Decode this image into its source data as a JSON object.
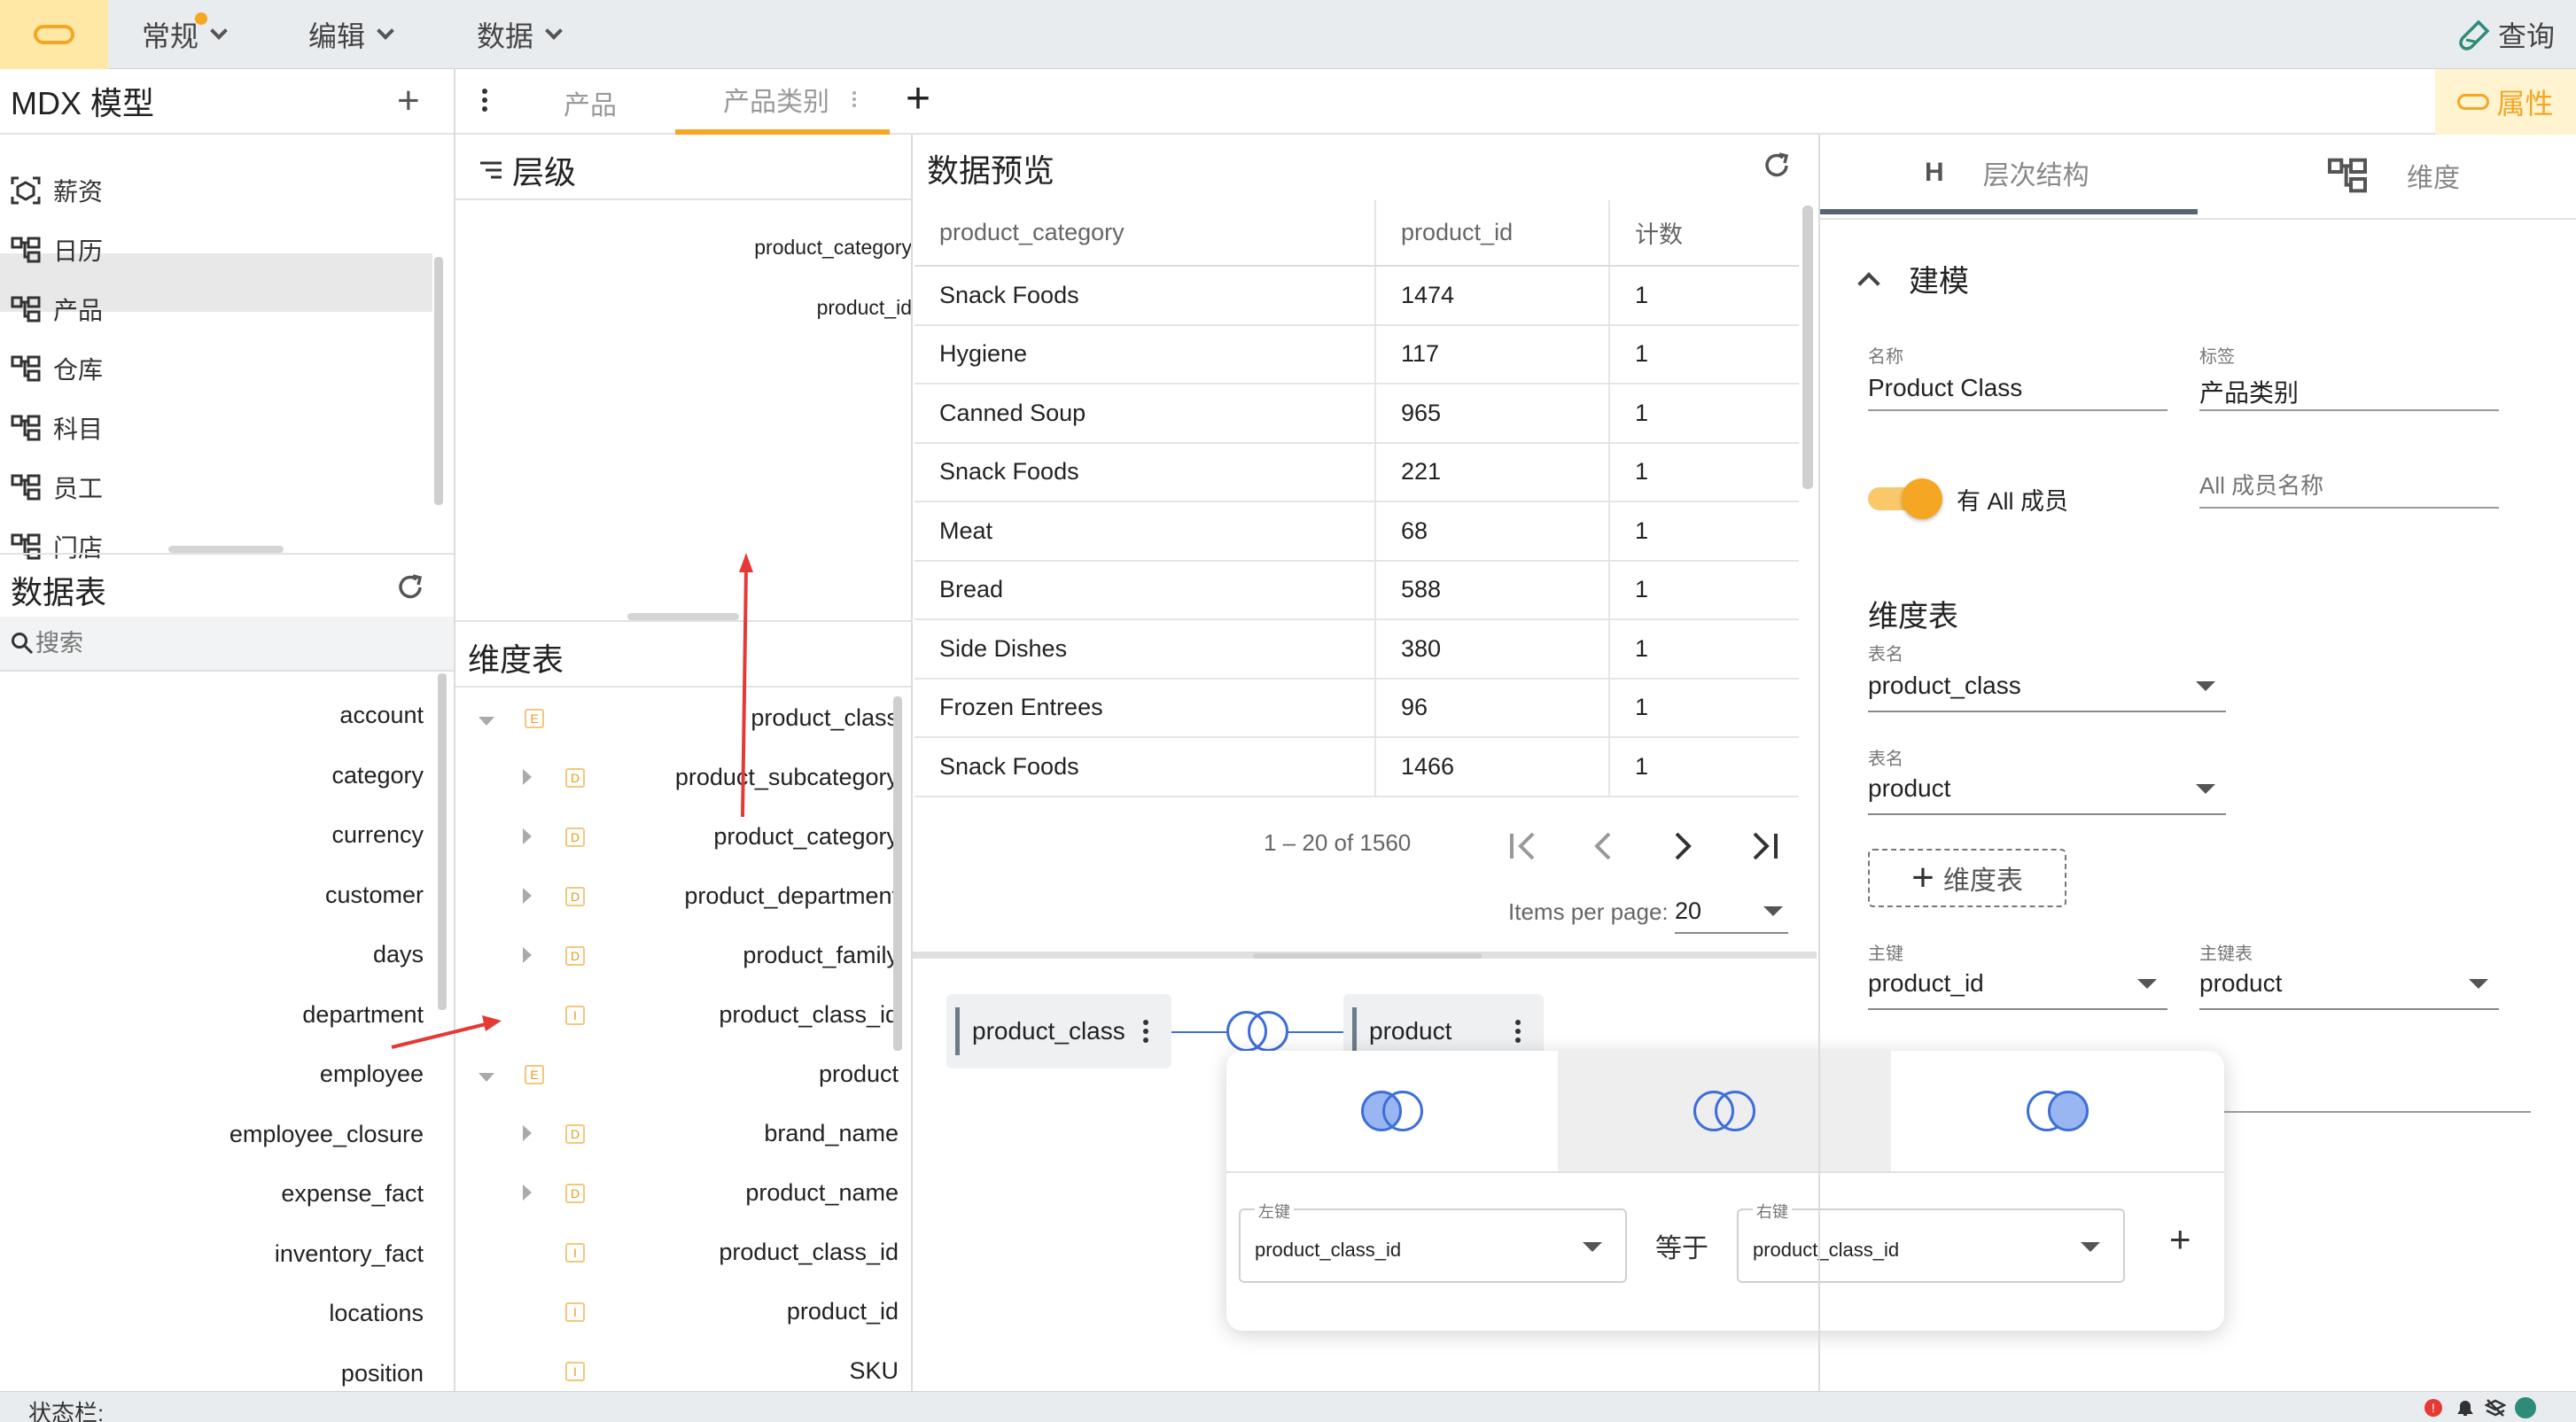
{
  "topbar": {
    "menus": [
      "常规",
      "编辑",
      "数据"
    ],
    "query_label": "查询"
  },
  "model_panel": {
    "title": "MDX 模型",
    "items": [
      {
        "label": "薪资",
        "icon": "cube-scan-icon"
      },
      {
        "label": "日历",
        "icon": "hierarchy-icon"
      },
      {
        "label": "产品",
        "icon": "hierarchy-icon",
        "selected": true
      },
      {
        "label": "仓库",
        "icon": "hierarchy-icon"
      },
      {
        "label": "科目",
        "icon": "hierarchy-icon"
      },
      {
        "label": "员工",
        "icon": "hierarchy-icon"
      },
      {
        "label": "门店",
        "icon": "hierarchy-icon"
      }
    ]
  },
  "tables_panel": {
    "title": "数据表",
    "search_placeholder": "搜索",
    "items": [
      "account",
      "category",
      "currency",
      "customer",
      "days",
      "department",
      "employee",
      "employee_closure",
      "expense_fact",
      "inventory_fact",
      "locations",
      "position"
    ]
  },
  "tabs": {
    "items": [
      "产品",
      "产品类别"
    ],
    "active": 1
  },
  "levels_panel": {
    "title": "层级",
    "items": [
      "product_category",
      "product_id"
    ]
  },
  "dim_tables_panel": {
    "title": "维度表",
    "rows": [
      {
        "badge": "E",
        "label": "product_class",
        "expand": "down",
        "indent": 0
      },
      {
        "badge": "D",
        "label": "product_subcategory",
        "expand": "right",
        "indent": 1
      },
      {
        "badge": "D",
        "label": "product_category",
        "expand": "right",
        "indent": 1
      },
      {
        "badge": "D",
        "label": "product_department",
        "expand": "right",
        "indent": 1
      },
      {
        "badge": "D",
        "label": "product_family",
        "expand": "right",
        "indent": 1
      },
      {
        "badge": "I",
        "label": "product_class_id",
        "expand": "",
        "indent": 1
      },
      {
        "badge": "E",
        "label": "product",
        "expand": "down",
        "indent": 0
      },
      {
        "badge": "D",
        "label": "brand_name",
        "expand": "right",
        "indent": 1
      },
      {
        "badge": "D",
        "label": "product_name",
        "expand": "right",
        "indent": 1
      },
      {
        "badge": "I",
        "label": "product_class_id",
        "expand": "",
        "indent": 1
      },
      {
        "badge": "I",
        "label": "product_id",
        "expand": "",
        "indent": 1
      },
      {
        "badge": "I",
        "label": "SKU",
        "expand": "",
        "indent": 1
      }
    ]
  },
  "preview_panel": {
    "title": "数据预览",
    "columns": [
      "product_category",
      "product_id",
      "计数"
    ],
    "rows": [
      [
        "Snack Foods",
        "1474",
        "1"
      ],
      [
        "Hygiene",
        "117",
        "1"
      ],
      [
        "Canned Soup",
        "965",
        "1"
      ],
      [
        "Snack Foods",
        "221",
        "1"
      ],
      [
        "Meat",
        "68",
        "1"
      ],
      [
        "Bread",
        "588",
        "1"
      ],
      [
        "Side Dishes",
        "380",
        "1"
      ],
      [
        "Frozen Entrees",
        "96",
        "1"
      ],
      [
        "Snack Foods",
        "1466",
        "1"
      ]
    ],
    "range_label": "1 – 20 of 1560",
    "items_per_page_label": "Items per page:",
    "items_per_page": "20"
  },
  "join_diagram": {
    "left_table": "product_class",
    "right_table": "product",
    "popup": {
      "left_key_label": "左键",
      "left_key": "product_class_id",
      "equals_label": "等于",
      "right_key_label": "右键",
      "right_key": "product_class_id"
    }
  },
  "props_panel": {
    "tab_label": "属性",
    "subtabs": [
      {
        "label": "层次结构",
        "icon": "H"
      },
      {
        "label": "维度",
        "icon": "hierarchy-icon"
      }
    ],
    "section_title": "建模",
    "name_label": "名称",
    "name_value": "Product Class",
    "caption_label": "标签",
    "caption_value": "产品类别",
    "has_all_label": "有 All 成员",
    "all_member_placeholder": "All 成员名称",
    "dim_tables_title": "维度表",
    "table1_label": "表名",
    "table1_value": "product_class",
    "table2_label": "表名",
    "table2_value": "product",
    "add_dim_table_label": "维度表",
    "pk_label": "主键",
    "pk_value": "product_id",
    "pk_table_label": "主键表",
    "pk_table_value": "product"
  },
  "status_bar": {
    "label": "状态栏:"
  },
  "colors": {
    "accent": "#f5a623",
    "link_blue": "#3d6fd8",
    "arrow_red": "#e53935"
  }
}
